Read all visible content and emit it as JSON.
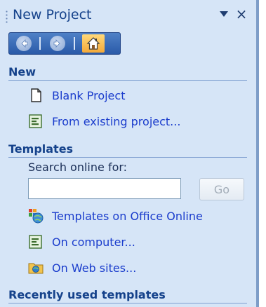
{
  "pane": {
    "title": "New Project",
    "menu_icon": "dropdown-arrow-icon",
    "close_label": "×"
  },
  "nav": {
    "back_icon": "back-arrow-icon",
    "forward_icon": "forward-arrow-icon",
    "home_icon": "home-icon"
  },
  "sections": {
    "new": {
      "heading": "New",
      "items": [
        {
          "label": "Blank Project",
          "icon": "blank-document-icon"
        },
        {
          "label": "From existing project...",
          "icon": "project-file-icon"
        }
      ]
    },
    "templates": {
      "heading": "Templates",
      "search_label": "Search online for:",
      "search_value": "",
      "go_label": "Go",
      "items": [
        {
          "label": "Templates on Office Online",
          "icon": "office-online-icon"
        },
        {
          "label": "On computer...",
          "icon": "project-file-icon"
        },
        {
          "label": "On Web sites...",
          "icon": "web-folder-icon"
        }
      ]
    },
    "recent": {
      "heading": "Recently used templates"
    }
  },
  "colors": {
    "pane_background": "#d6e5f7",
    "heading_text": "#15428b",
    "link_text": "#1a3ccc",
    "toolbar": "#2a5aa8",
    "home_button": "#f4a93a"
  }
}
